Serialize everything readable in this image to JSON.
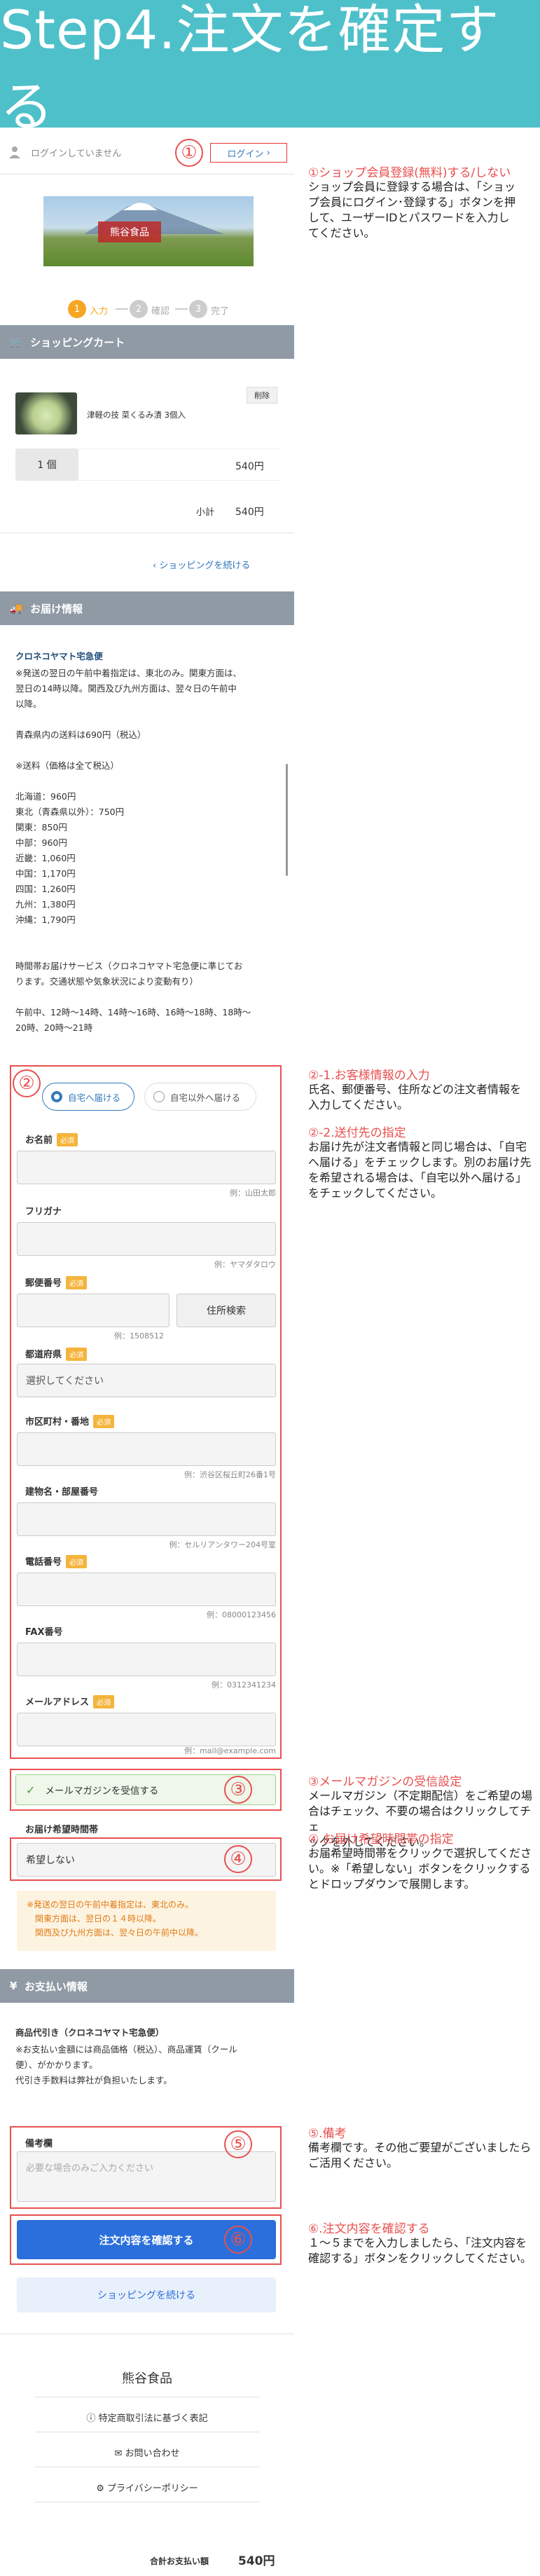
{
  "banner": {
    "title": "Step4.注文を確定する"
  },
  "header": {
    "login_status": "ログインしていません",
    "login_button": "ログイン"
  },
  "logo": {
    "text": "熊谷食品"
  },
  "steps": [
    {
      "num": "1",
      "label": "入力"
    },
    {
      "num": "2",
      "label": "確認"
    },
    {
      "num": "3",
      "label": "完了"
    }
  ],
  "cart": {
    "title": "ショッピングカート",
    "delete": "削除",
    "item_name": "津軽の技 菜くるみ漬 3個入",
    "quantity": "1 個",
    "price": "540円",
    "subtotal_label": "小計",
    "subtotal": "540円",
    "continue": "ショッピングを続ける"
  },
  "delivery": {
    "title": "お届け情報",
    "carrier": "クロネコヤマト宅急便",
    "lines": [
      "※発送の翌日の午前中着指定は、東北のみ。関東方面は、",
      "翌日の14時以降。関西及び九州方面は、翌々日の午前中",
      "以降。",
      "",
      "青森県内の送料は690円（税込）",
      "",
      "※送料（価格は全て税込）",
      "",
      "北海道：960円",
      "東北（青森県以外）：750円",
      "関東：850円",
      "中部：960円",
      "近畿：1,060円",
      "中国：1,170円",
      "四国：1,260円",
      "九州：1,380円",
      "沖縄：1,790円",
      "",
      "",
      "時間帯お届けサービス（クロネコヤマト宅急便に準じてお",
      "ります。交通状態や気象状況により変動有り）",
      "",
      "午前中、12時〜14時、14時〜16時、16時〜18時、18時〜",
      "20時、20時〜21時"
    ]
  },
  "form": {
    "radio_home": "自宅へ届ける",
    "radio_other": "自宅以外へ届ける",
    "required": "必須",
    "name_label": "お名前",
    "name_ex": "例：山田太郎",
    "kana_label": "フリガナ",
    "kana_ex": "例：ヤマダタロウ",
    "zip_label": "郵便番号",
    "zip_ex": "例：1508512",
    "zip_btn": "住所検索",
    "pref_label": "都道府県",
    "pref_value": "選択してください",
    "city_label": "市区町村・番地",
    "city_ex": "例：渋谷区桜丘町26番1号",
    "bldg_label": "建物名・部屋番号",
    "bldg_ex": "例：セルリアンタワー204号室",
    "tel_label": "電話番号",
    "tel_ex": "例：08000123456",
    "fax_label": "FAX番号",
    "fax_ex": "例：0312341234",
    "mail_label": "メールアドレス",
    "mail_ex": "例：mail@example.com",
    "mag_label": "メールマガジンを受信する",
    "time_label": "お届け希望時間帯",
    "time_value": "希望しない",
    "notice": [
      "※発送の翌日の午前中着指定は、東北のみ。",
      "関東方面は、翌日の１４時以降。",
      "関西及び九州方面は、翌々日の午前中以降。"
    ]
  },
  "payment": {
    "title": "お支払い情報",
    "method": "商品代引き（クロネコヤマト宅急便）",
    "lines": [
      "※お支払い金額には商品価格（税込）、商品運賃（クール",
      "便）、がかかります。",
      "代引き手数料は弊社が負担いたします。"
    ]
  },
  "remarks": {
    "label": "備考欄",
    "placeholder": "必要な場合のみご入力ください"
  },
  "actions": {
    "confirm": "注文内容を確認する",
    "continue": "ショッピングを続ける"
  },
  "footer": {
    "brand": "熊谷食品",
    "links": [
      "特定商取引法に基づく表記",
      "お問い合わせ",
      "プライバシーポリシー"
    ],
    "total_label": "合計お支払い額",
    "total": "540円"
  },
  "annotations": [
    {
      "num": "①",
      "title": "①ショップ会員登録(無料)する/しない",
      "body": [
        "ショップ会員に登録する場合は、「ショッ",
        "プ会員にログイン･登録する」ボタンを押",
        "して、ユーザーIDとパスワードを入力し",
        "てください。"
      ]
    },
    {
      "num": "②",
      "title": "②-1.お客様情報の入力",
      "body": [
        "氏名、郵便番号、住所などの注文者情報を",
        "入力してください。"
      ],
      "title2": "②-2.送付先の指定",
      "body2": [
        "お届け先が注文者情報と同じ場合は、「自宅",
        "へ届ける」をチェックします。別のお届け先",
        "を希望される場合は、「自宅以外へ届ける」",
        "をチェックしてください。"
      ]
    },
    {
      "num": "③",
      "title": "③メールマガジンの受信設定",
      "body": [
        "メールマガジン（不定期配信）をご希望の場",
        "合はチェック、不要の場合はクリックしてチェ",
        "ックを外してください。"
      ]
    },
    {
      "num": "④",
      "title": "④.お届け希望時間帯の指定",
      "body": [
        "お届希望時間帯をクリックで選択してくださ",
        "い。※「希望しない」ボタンをクリックする",
        "とドロップダウンで展開します。"
      ]
    },
    {
      "num": "⑤",
      "title": "⑤.備考",
      "body": [
        "備考欄です。その他ご要望がございましたら",
        "ご活用ください。"
      ]
    },
    {
      "num": "⑥",
      "title": "⑥.注文内容を確認する",
      "body": [
        "１〜５までを入力しましたら、「注文内容を",
        "確認する」ボタンをクリックしてください。"
      ]
    }
  ],
  "colors": {
    "banner": "#4ec0ca",
    "accent": "#f5a623",
    "section": "#8f9aa5",
    "annotation": "#e8504f",
    "primary_button": "#2a6fdb",
    "link": "#3377bb"
  }
}
